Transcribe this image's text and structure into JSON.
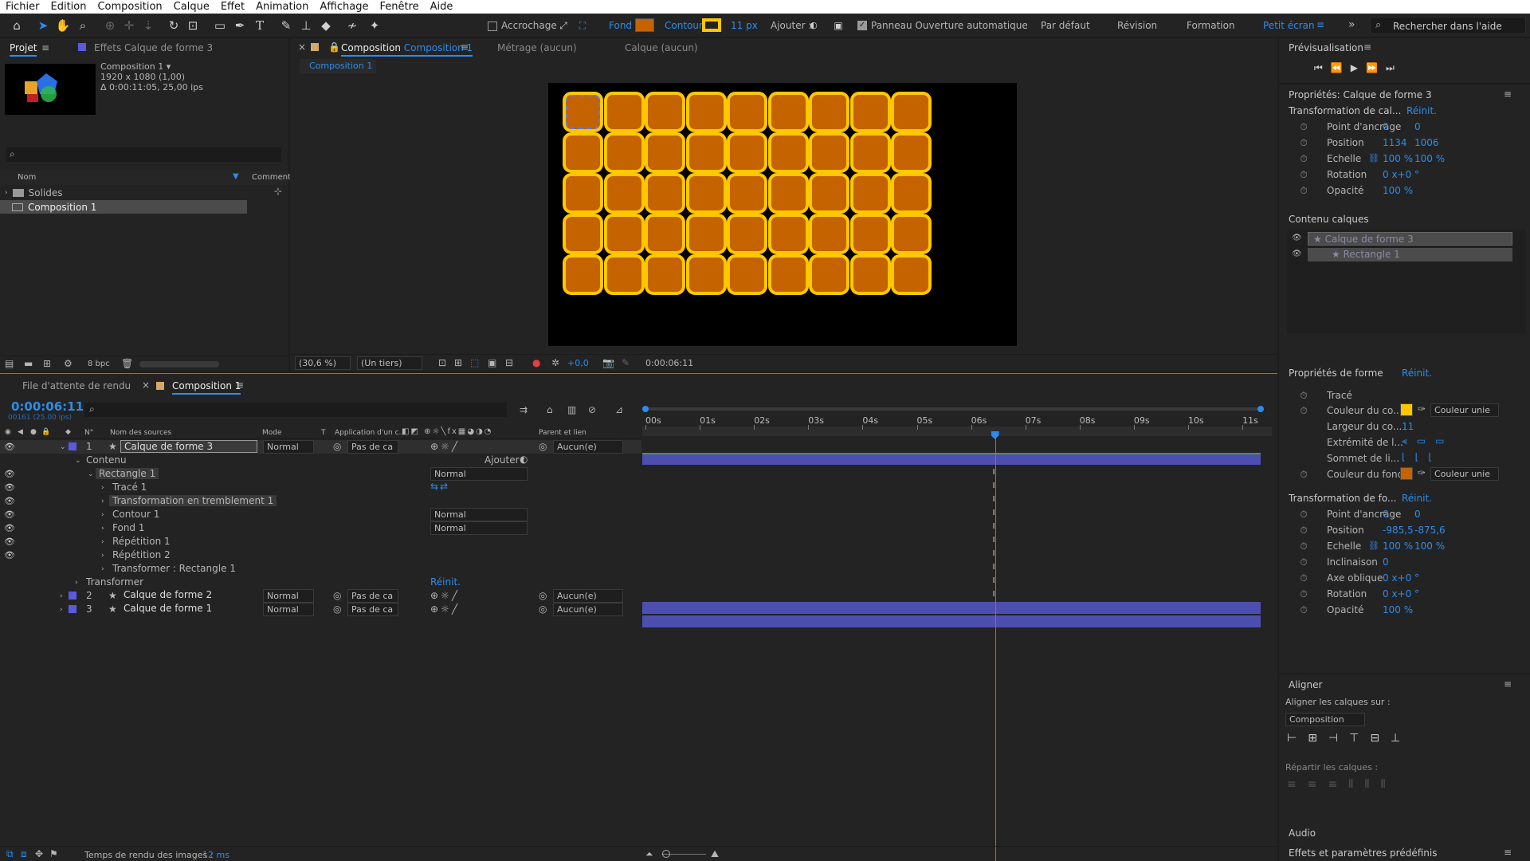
{
  "menu": [
    "Fichier",
    "Edition",
    "Composition",
    "Calque",
    "Effet",
    "Animation",
    "Affichage",
    "Fenêtre",
    "Aide"
  ],
  "toolbar": {
    "snapping": "Accrochage",
    "fill_label": "Fond",
    "stroke_label": "Contour",
    "stroke_px": "11 px",
    "add_label": "Ajouter :",
    "auto_open": "Panneau Ouverture automatique",
    "workspaces": [
      "Par défaut",
      "Révision",
      "Formation",
      "Petit écran"
    ],
    "search_placeholder": "Rechercher dans l'aide",
    "fill_color": "#c46300",
    "stroke_color": "#ffc700"
  },
  "project": {
    "tab": "Projet",
    "effects_tab": "Effets  Calque de forme 3",
    "comp_name": "Composition 1 ▾",
    "comp_info1": "1920 x 1080 (1,00)",
    "comp_info2": "Δ 0:00:11:05, 25,00 ips",
    "col_name": "Nom",
    "col_comment": "Commenta",
    "items": [
      "Solides",
      "Composition 1"
    ],
    "bpc": "8 bpc"
  },
  "viewer": {
    "tab_close": "×",
    "tab_comp": "Composition",
    "tab_comp_name": "Composition 1",
    "tab_footage": "Métrage  (aucun)",
    "tab_layer": "Calque  (aucun)",
    "subtab": "Composition 1",
    "zoom": "(30,6 %)",
    "resolution": "(Un tiers)",
    "exposure": "+0,0",
    "timecode": "0:00:06:11"
  },
  "timeline": {
    "render_queue_tab": "File d'attente de rendu",
    "comp_tab": "Composition 1",
    "timecode": "0:00:06:11",
    "frames": "00161 (25.00 ips)",
    "col_headers": {
      "num": "N°",
      "source": "Nom des sources",
      "mode": "Mode",
      "t": "T",
      "track": "Application d'un c...",
      "parent": "Parent et lien"
    },
    "layers": [
      {
        "num": "1",
        "name": "Calque de forme 3",
        "mode": "Normal",
        "track": "Pas de ca",
        "parent": "Aucun(e)"
      },
      {
        "num": "2",
        "name": "Calque de forme 2",
        "mode": "Normal",
        "track": "Pas de ca",
        "parent": "Aucun(e)"
      },
      {
        "num": "3",
        "name": "Calque de forme 1",
        "mode": "Normal",
        "track": "Pas de ca",
        "parent": "Aucun(e)"
      }
    ],
    "contents": "Contenu",
    "add": "Ajouter :",
    "rect": "Rectangle 1",
    "rect_mode": "Normal",
    "path": "Tracé 1",
    "wiggle": "Transformation en tremblement 1",
    "stroke": "Contour 1",
    "stroke_mode": "Normal",
    "fill": "Fond 1",
    "fill_mode": "Normal",
    "rep1": "Répétition 1",
    "rep2": "Répétition 2",
    "transform_rect": "Transformer : Rectangle 1",
    "transform": "Transformer",
    "reset": "Réinit.",
    "ruler": [
      "00s",
      "01s",
      "02s",
      "03s",
      "04s",
      "05s",
      "06s",
      "07s",
      "08s",
      "09s",
      "10s",
      "11s"
    ],
    "playhead_seconds": 6.44,
    "render_time_label": "Temps de rendu des images :",
    "render_time_value": "12 ms"
  },
  "preview": {
    "title": "Prévisualisation"
  },
  "properties": {
    "title": "Propriétés: Calque de forme 3",
    "layer_transform": "Transformation de cal...",
    "reset": "Réinit.",
    "layer_props": [
      {
        "label": "Point d'ancrage",
        "v1": "0",
        "v2": "0"
      },
      {
        "label": "Position",
        "v1": "1134",
        "v2": "1006"
      },
      {
        "label": "Echelle",
        "v1": "100 %",
        "v2": "100 %"
      },
      {
        "label": "Rotation",
        "v1": "0 x+0 °",
        "v2": ""
      },
      {
        "label": "Opacité",
        "v1": "100 %",
        "v2": ""
      }
    ],
    "contents_title": "Contenu calques",
    "contents": [
      "Calque de forme 3",
      "Rectangle 1"
    ],
    "shape_props_title": "Propriétés de forme",
    "stroke": "Tracé",
    "stroke_color_label": "Couleur du co...",
    "stroke_width_label": "Largeur du co...",
    "stroke_width": "11",
    "cap_label": "Extrémité de l...",
    "join_label": "Sommet de li...",
    "fill_color_label": "Couleur du fond",
    "solid": "Couleur unie",
    "stroke_color": "#ffc700",
    "fill_color": "#c46300",
    "shape_transform_title": "Transformation de fo...",
    "shape_props": [
      {
        "label": "Point d'ancrage",
        "v1": "0",
        "v2": "0"
      },
      {
        "label": "Position",
        "v1": "-985,5",
        "v2": "-875,6"
      },
      {
        "label": "Echelle",
        "v1": "100 %",
        "v2": "100 %"
      },
      {
        "label": "Inclinaison",
        "v1": "0",
        "v2": ""
      },
      {
        "label": "Axe oblique",
        "v1": "0 x+0 °",
        "v2": ""
      },
      {
        "label": "Rotation",
        "v1": "0 x+0 °",
        "v2": ""
      },
      {
        "label": "Opacité",
        "v1": "100 %",
        "v2": ""
      }
    ]
  },
  "align": {
    "title": "Aligner",
    "align_to": "Aligner les calques sur :",
    "target": "Composition",
    "distribute": "Répartir les calques :"
  },
  "audio": {
    "title": "Audio"
  },
  "effects": {
    "title": "Effets et paramètres prédéfinis"
  }
}
